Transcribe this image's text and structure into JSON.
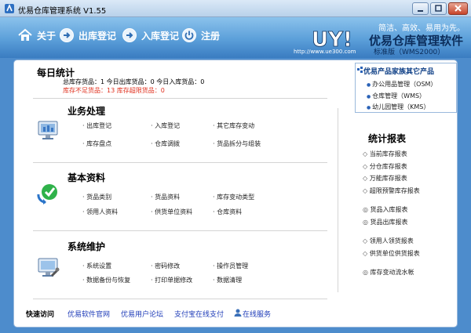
{
  "window": {
    "title": "优易仓库管理系统 V1.55"
  },
  "header": {
    "nav": [
      {
        "label": "关于",
        "icon": "home-icon"
      },
      {
        "label": "出库登记",
        "icon": "arrow-right-circle-icon"
      },
      {
        "label": "入库登记",
        "icon": "arrow-right-circle-icon"
      },
      {
        "label": "注册",
        "icon": "power-icon"
      }
    ],
    "slogan": "简洁、高效、易用为先。",
    "brand": {
      "logo_text": "UY!",
      "name": "优易仓库管理软件",
      "edition": "标准版（WMS2000）",
      "url": "http://www.ue300.com"
    }
  },
  "daily": {
    "title": "每日统计",
    "line1": "总库存货品：1   今日出库货品：0   今日入库货品：0",
    "line2": "库存不足货品：13   库存超限货品：0"
  },
  "sections": [
    {
      "title": "业务处理",
      "icon": "business-monitor-icon",
      "items": [
        "出库登记",
        "入库登记",
        "其它库存变动",
        "库存盘点",
        "仓库调拨",
        "货品拆分与组装"
      ]
    },
    {
      "title": "基本资料",
      "icon": "checkmark-refresh-icon",
      "items": [
        "货品类别",
        "货品资料",
        "库存变动类型",
        "领用人资料",
        "供货单位资料",
        "仓库资料"
      ]
    },
    {
      "title": "系统维护",
      "icon": "system-maintenance-icon",
      "items": [
        "系统设置",
        "密码修改",
        "操作员管理",
        "数据备份与恢复",
        "打印单据修改",
        "数据清理"
      ]
    }
  ],
  "family": {
    "title": "优易产品家族其它产品",
    "items": [
      "办公用品管理（OSM）",
      "仓库管理（WMS）",
      "幼儿园管理（KMS）"
    ]
  },
  "reports": {
    "title": "统计报表",
    "items": [
      {
        "label": "当前库存报表",
        "marker": "diamond"
      },
      {
        "label": "分仓库存报表",
        "marker": "diamond"
      },
      {
        "label": "万能库存报表",
        "marker": "diamond"
      },
      {
        "label": "超限预警库存报表",
        "marker": "diamond"
      },
      {
        "label": "货品入库报表",
        "marker": "disc"
      },
      {
        "label": "货品出库报表",
        "marker": "disc"
      },
      {
        "label": "领用人领货报表",
        "marker": "diamond"
      },
      {
        "label": "供货单位供货报表",
        "marker": "diamond"
      },
      {
        "label": "库存变动流水帐",
        "marker": "disc"
      }
    ]
  },
  "quick": {
    "label": "快速访问",
    "links": [
      "优易软件官网",
      "优易用户论坛",
      "支付宝在线支付",
      "在线服务"
    ]
  },
  "colors": {
    "header_blue": "#5b9fd9",
    "frame_blue": "#4d8ccc",
    "warning_red": "#e0301e",
    "link_blue": "#1f3cb8"
  }
}
